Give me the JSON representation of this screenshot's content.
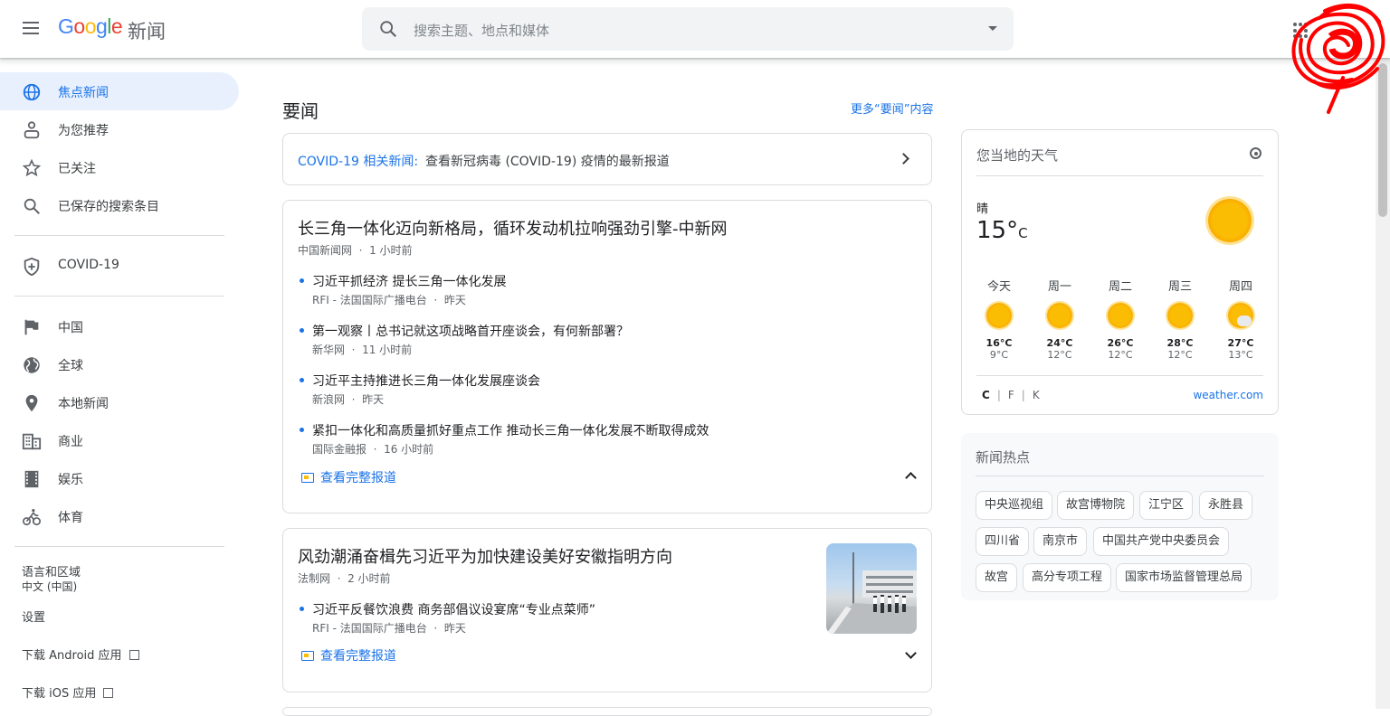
{
  "header": {
    "logo_parts": [
      "G",
      "o",
      "o",
      "g",
      "l",
      "e"
    ],
    "logo_sub": "新闻",
    "search_placeholder": "搜索主题、地点和媒体"
  },
  "sidebar": {
    "items": [
      {
        "label": "焦点新闻",
        "icon": "globe-icon"
      },
      {
        "label": "为您推荐",
        "icon": "person-icon"
      },
      {
        "label": "已关注",
        "icon": "star-icon"
      },
      {
        "label": "已保存的搜索条目",
        "icon": "search-icon"
      },
      {
        "label": "COVID-19",
        "icon": "shield-plus-icon"
      },
      {
        "label": "中国",
        "icon": "flag-icon"
      },
      {
        "label": "全球",
        "icon": "world-icon"
      },
      {
        "label": "本地新闻",
        "icon": "pin-icon"
      },
      {
        "label": "商业",
        "icon": "building-icon"
      },
      {
        "label": "娱乐",
        "icon": "film-icon"
      },
      {
        "label": "体育",
        "icon": "bike-icon"
      }
    ],
    "lang_label": "语言和区域",
    "lang_value": "中文 (中国)",
    "settings": "设置",
    "android": "下载 Android 应用",
    "ios": "下载 iOS 应用"
  },
  "main": {
    "section_title": "要闻",
    "more_link": "更多“要闻”内容",
    "covid_key": "COVID-19 相关新闻:",
    "covid_text": "查看新冠病毒 (COVID-19) 疫情的最新报道",
    "full_coverage": "查看完整报道",
    "stories": [
      {
        "headline": "长三角一体化迈向新格局，循环发动机拉响强劲引擎-中新网",
        "source": "中国新闻网",
        "time": "1 小时前",
        "related": [
          {
            "title": "习近平抓经济 提长三角一体化发展",
            "source": "RFI - 法国国际广播电台",
            "time": "昨天"
          },
          {
            "title": "第一观察丨总书记就这项战略首开座谈会，有何新部署？",
            "source": "新华网",
            "time": "11 小时前"
          },
          {
            "title": "习近平主持推进长三角一体化发展座谈会",
            "source": "新浪网",
            "time": "昨天"
          },
          {
            "title": "紧扣一体化和高质量抓好重点工作 推动长三角一体化发展不断取得成效",
            "source": "国际金融报",
            "time": "16 小时前"
          }
        ]
      },
      {
        "headline": "风劲潮涌奋楫先习近平为加快建设美好安徽指明方向",
        "source": "法制网",
        "time": "2 小时前",
        "related": [
          {
            "title": "习近平反餐饮浪费 商务部倡议设宴席“专业点菜师”",
            "source": "RFI - 法国国际广播电台",
            "time": "昨天"
          }
        ]
      }
    ]
  },
  "weather": {
    "title": "您当地的天气",
    "condition": "晴",
    "temp": "15°",
    "unit": "C",
    "days": [
      {
        "name": "今天",
        "hi": "16°C",
        "lo": "9°C"
      },
      {
        "name": "周一",
        "hi": "24°C",
        "lo": "12°C"
      },
      {
        "name": "周二",
        "hi": "26°C",
        "lo": "12°C"
      },
      {
        "name": "周三",
        "hi": "28°C",
        "lo": "12°C"
      },
      {
        "name": "周四",
        "hi": "27°C",
        "lo": "13°C"
      }
    ],
    "units": [
      "C",
      "F",
      "K"
    ],
    "source": "weather.com"
  },
  "trends": {
    "title": "新闻热点",
    "chips": [
      "中央巡视组",
      "故宫博物院",
      "江宁区",
      "永胜县",
      "四川省",
      "南京市",
      "中国共产党中央委员会",
      "故宫",
      "高分专项工程",
      "国家市场监督管理总局"
    ]
  },
  "colors": {
    "accent": "#1a73e8",
    "active_bg": "#e8f0fe",
    "sun": "#fbbc04",
    "scribble": "#ff0000"
  }
}
